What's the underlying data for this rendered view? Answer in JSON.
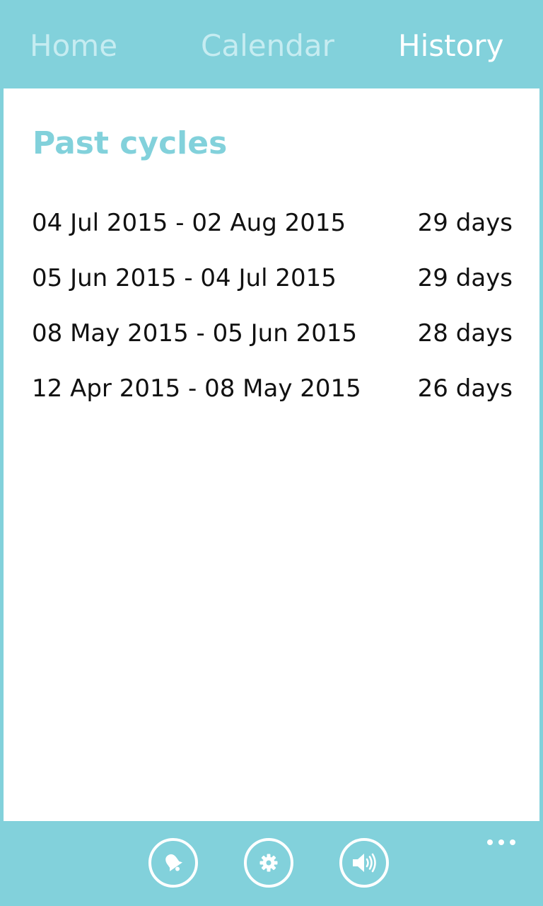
{
  "pivot": {
    "tabs": [
      {
        "label": "Home",
        "active": false
      },
      {
        "label": "Calendar",
        "active": false
      },
      {
        "label": "History",
        "active": true
      }
    ]
  },
  "history": {
    "title": "Past cycles",
    "cycles": [
      {
        "range": "04 Jul 2015 - 02 Aug 2015",
        "days": "29 days"
      },
      {
        "range": "05 Jun 2015 - 04 Jul 2015",
        "days": "29 days"
      },
      {
        "range": "08 May 2015 - 05 Jun 2015",
        "days": "28 days"
      },
      {
        "range": "12 Apr 2015 - 08 May 2015",
        "days": "26 days"
      }
    ]
  },
  "appbar": {
    "buttons": [
      {
        "icon": "bell-icon"
      },
      {
        "icon": "gear-icon"
      },
      {
        "icon": "speaker-icon"
      }
    ],
    "more": "more-dots-icon"
  },
  "colors": {
    "accent": "#82d1db",
    "panel": "#ffffff",
    "text": "#111111",
    "inactive_tab": "#c6ecf1"
  }
}
